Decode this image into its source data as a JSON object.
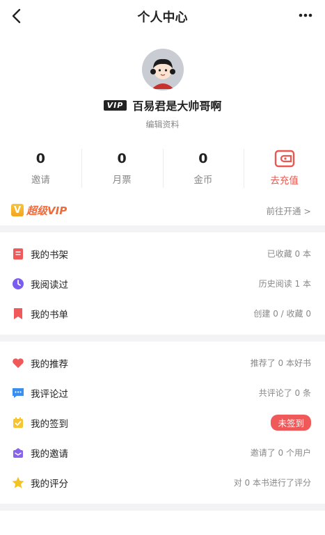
{
  "header": {
    "title": "个人中心"
  },
  "profile": {
    "vip_badge": "VIP",
    "username": "百易君是大帅哥啊",
    "edit_label": "编辑资料"
  },
  "stats": [
    {
      "value": "0",
      "label": "邀请"
    },
    {
      "value": "0",
      "label": "月票"
    },
    {
      "value": "0",
      "label": "金币"
    }
  ],
  "recharge": {
    "label": "去充值",
    "icon": "wallet-icon"
  },
  "vip_banner": {
    "icon_char": "V",
    "title": "超级VIP",
    "link": "前往开通 >"
  },
  "group1": [
    {
      "label": "我的书架",
      "value": "已收藏 0 本",
      "icon": "bookshelf-icon"
    },
    {
      "label": "我阅读过",
      "value": "历史阅读 1 本",
      "icon": "clock-icon"
    },
    {
      "label": "我的书单",
      "value": "创建 0 / 收藏 0",
      "icon": "bookmark-icon"
    }
  ],
  "group2": [
    {
      "label": "我的推荐",
      "value": "推荐了 0 本好书",
      "icon": "heart-icon"
    },
    {
      "label": "我评论过",
      "value": "共评论了 0 条",
      "icon": "comment-icon"
    },
    {
      "label": "我的签到",
      "value": "未签到",
      "icon": "checkin-icon"
    },
    {
      "label": "我的邀请",
      "value": "邀请了 0 个用户",
      "icon": "invite-icon"
    },
    {
      "label": "我的评分",
      "value": "对 0 本书进行了评分",
      "icon": "star-icon"
    }
  ],
  "colors": {
    "accent_red": "#e9574f",
    "vip_orange": "#f06b3a",
    "checkin_pill": "#f0595a"
  }
}
